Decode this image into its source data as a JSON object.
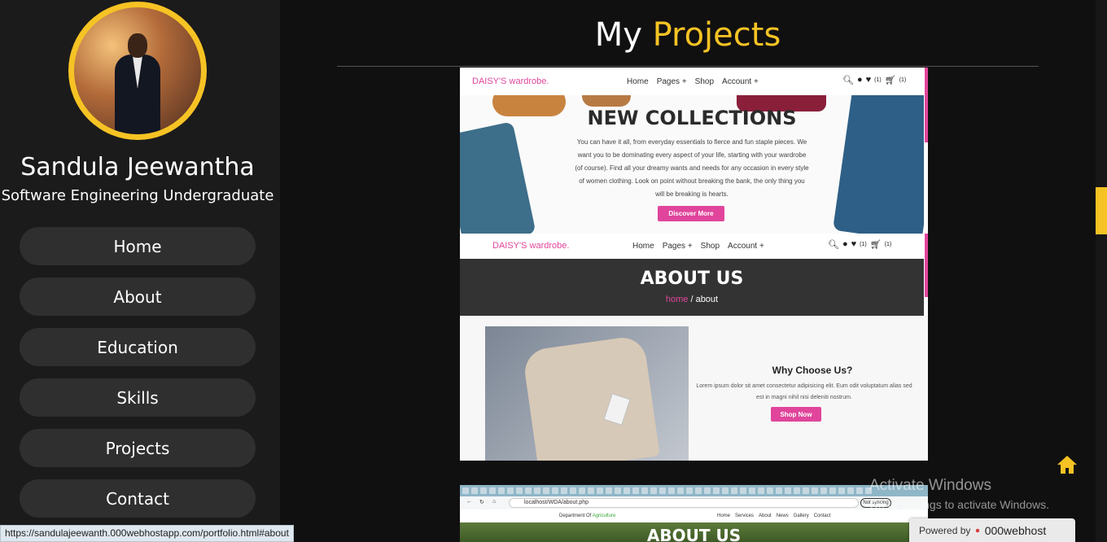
{
  "profile": {
    "name": "Sandula Jeewantha",
    "subtitle": "Software Engineering Undergraduate"
  },
  "nav": [
    "Home",
    "About",
    "Education",
    "Skills",
    "Projects",
    "Contact"
  ],
  "status_url": "https://sandulajeewanth.000webhostapp.com/portfolio.html#about",
  "page_title": {
    "prefix": "My",
    "accent": "Projects"
  },
  "project1": {
    "logo": "DAISY'S wardrobe.",
    "links": [
      "Home",
      "Pages +",
      "Shop",
      "Account +"
    ],
    "counts": [
      "(1)",
      "(1)"
    ],
    "hero_title": "NEW COLLECTIONS",
    "hero_text": "You can have it all, from everyday essentials to fierce and fun staple pieces. We want you to be dominating every aspect of your life, starting with your wardrobe (of course). Find all your dreamy wants and needs for any occasion in every style of women clothing. Look on point without breaking the bank, the only thing you will be breaking is hearts.",
    "hero_button": "Discover More",
    "about_title": "ABOUT US",
    "crumb_home": "home",
    "crumb_rest": " / about",
    "why_title": "Why Choose Us?",
    "why_text": "Lorem ipsum dolor sit amet consectetur adipisicing elit. Eum odit voluptatum alias sed est in magni nihil nisi deleniti nostrum.",
    "shop_button": "Shop Now"
  },
  "project2": {
    "address": "localhost/WDA/about.php",
    "not_secure": "Not syncing",
    "dept_prefix": "Department Of",
    "dept_name": "Agriculture",
    "links": [
      "Home",
      "Services",
      "About",
      "News",
      "Gallery",
      "Contact"
    ],
    "hero_title": "ABOUT US"
  },
  "watermark": {
    "line1": "Activate Windows",
    "line2": "Go to Settings to activate Windows."
  },
  "powered": {
    "label": "Powered by",
    "brand": "000webhost"
  },
  "colors": {
    "accent": "#f6c324",
    "pink": "#e0459b",
    "sidebar": "#1b1b1b",
    "background": "#111011"
  }
}
